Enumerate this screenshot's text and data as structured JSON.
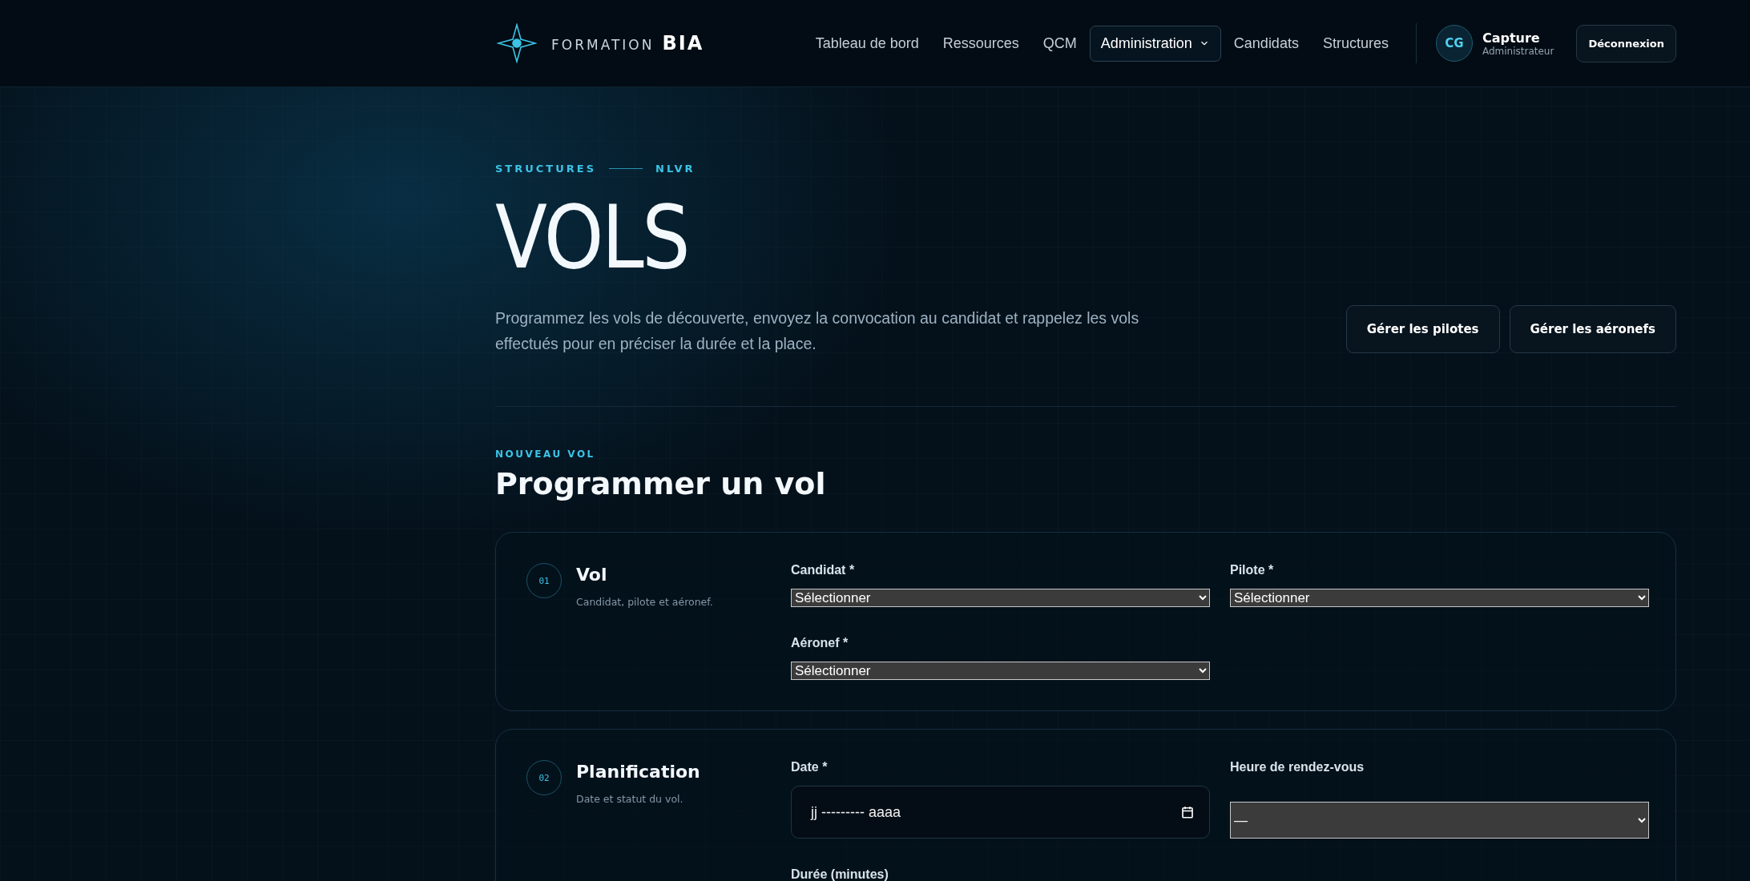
{
  "header": {
    "logo": {
      "prefix": "FORMATION",
      "name": "BIA"
    },
    "nav": [
      {
        "label": "Tableau de bord",
        "selected": false,
        "kind": "link"
      },
      {
        "label": "Ressources",
        "selected": false,
        "kind": "link"
      },
      {
        "label": "QCM",
        "selected": false,
        "kind": "link"
      },
      {
        "label": "Administration",
        "selected": true,
        "kind": "dropdown"
      },
      {
        "label": "Candidats",
        "selected": false,
        "kind": "link"
      },
      {
        "label": "Structures",
        "selected": false,
        "kind": "link"
      }
    ],
    "user": {
      "initials": "CG",
      "name": "Capture",
      "role": "Administrateur"
    },
    "logout": "Déconnexion"
  },
  "breadcrumb": [
    "STRUCTURES",
    "NLVR"
  ],
  "page_title": "VOLS",
  "intro": "Programmez les vols de découverte, envoyez la convocation au candidat et rappelez les vols effectués pour en préciser la durée et la place.",
  "actions": [
    "Gérer les pilotes",
    "Gérer les aéronefs"
  ],
  "section": {
    "eyebrow": "NOUVEAU VOL",
    "title": "Programmer un vol"
  },
  "steps": [
    {
      "number": "01",
      "title": "Vol",
      "subtitle": "Candidat, pilote et aéronef.",
      "fields": [
        {
          "kind": "select",
          "label": "Candidat *",
          "value": "Sélectionner"
        },
        {
          "kind": "select",
          "label": "Pilote *",
          "value": "Sélectionner"
        },
        {
          "kind": "select",
          "label": "Aéronef *",
          "value": "Sélectionner"
        }
      ]
    },
    {
      "number": "02",
      "title": "Planification",
      "subtitle": "Date et statut du vol.",
      "fields": [
        {
          "kind": "date",
          "label": "Date *",
          "placeholder": "jj --------- aaaa"
        },
        {
          "kind": "select",
          "label": "Heure de rendez-vous",
          "value": "—"
        },
        {
          "kind": "number",
          "label": "Durée (minutes)"
        }
      ]
    }
  ]
}
